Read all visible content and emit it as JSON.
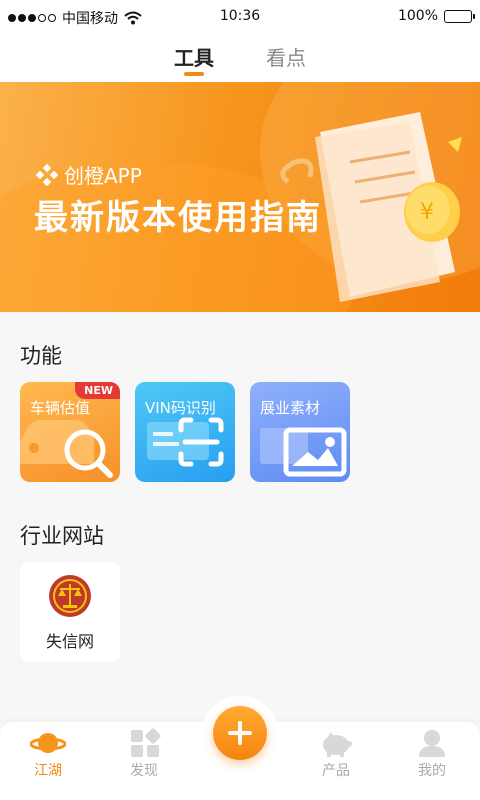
{
  "status_bar": {
    "carrier": "中国移动",
    "time": "10:36",
    "battery": "100%"
  },
  "top_tabs": [
    {
      "label": "工具",
      "active": true
    },
    {
      "label": "看点",
      "active": false
    }
  ],
  "banner": {
    "brand": "创橙APP",
    "headline": "最新版本使用指南"
  },
  "functions": {
    "title": "功能",
    "items": [
      {
        "label": "车辆估值",
        "badge": "NEW",
        "icon": "car-search-icon"
      },
      {
        "label": "VIN码识别",
        "icon": "scan-icon"
      },
      {
        "label": "展业素材",
        "icon": "image-icon"
      }
    ]
  },
  "industry_sites": {
    "title": "行业网站",
    "items": [
      {
        "name": "失信网",
        "icon": "court-emblem-icon"
      }
    ]
  },
  "bottom_nav": {
    "items": [
      {
        "label": "江湖",
        "icon": "planet-icon",
        "active": true
      },
      {
        "label": "发现",
        "icon": "discover-icon",
        "active": false
      },
      {
        "label": "产品",
        "icon": "piggy-bank-icon",
        "active": false
      },
      {
        "label": "我的",
        "icon": "user-icon",
        "active": false
      }
    ],
    "fab_icon": "plus-icon"
  },
  "colors": {
    "accent": "#f18a16",
    "banner_start": "#fbb14b",
    "banner_end": "#f27b0b"
  }
}
